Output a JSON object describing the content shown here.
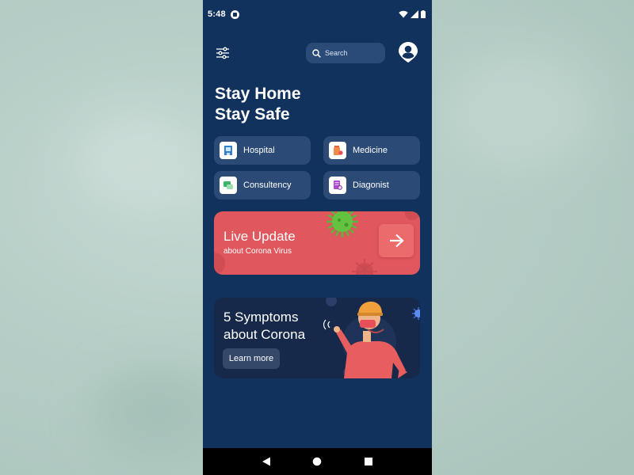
{
  "status_bar": {
    "time": "5:48",
    "icons": [
      "app-notification-icon",
      "wifi-icon",
      "signal-icon",
      "battery-icon"
    ]
  },
  "app_bar": {
    "filter_icon": "sliders-icon",
    "search_placeholder": "Search",
    "search_icon": "search-icon",
    "profile_icon": "user-location-icon"
  },
  "headline": {
    "line1": "Stay Home",
    "line2": "Stay Safe"
  },
  "categories": [
    {
      "label": "Hospital",
      "icon": "hospital-icon",
      "color": "#2f7fd6"
    },
    {
      "label": "Medicine",
      "icon": "medicine-icon",
      "color": "#f08a4b"
    },
    {
      "label": "Consultency",
      "icon": "chat-icon",
      "color": "#3bb36a"
    },
    {
      "label": "Diagonist",
      "icon": "diagnosis-icon",
      "color": "#b04ad0"
    }
  ],
  "live_update": {
    "title": "Live Update",
    "subtitle": "about Corona Virus",
    "arrow_icon": "arrow-right-icon",
    "color": "#e0575d"
  },
  "symptoms": {
    "line1": "5 Symptoms",
    "line2": "about Corona",
    "button": "Learn more"
  },
  "nav": [
    "back-icon",
    "home-icon",
    "recents-icon"
  ],
  "colors": {
    "background": "#12325e",
    "card": "#2b4a76",
    "accent_red": "#e0575d"
  }
}
